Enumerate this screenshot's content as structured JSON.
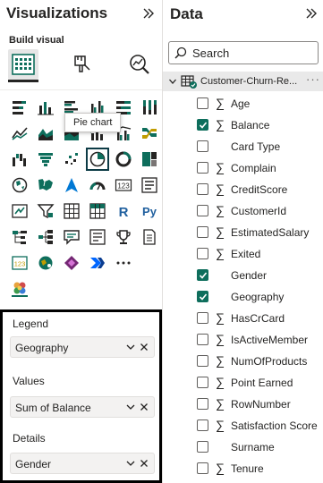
{
  "visualizations": {
    "title": "Visualizations",
    "build_label": "Build visual",
    "tooltip": "Pie chart",
    "wells": [
      {
        "label": "Legend",
        "value": "Geography"
      },
      {
        "label": "Values",
        "value": "Sum of Balance"
      },
      {
        "label": "Details",
        "value": "Gender"
      }
    ]
  },
  "data": {
    "title": "Data",
    "search_placeholder": "Search",
    "table_name": "Customer-Churn-Re...",
    "more": "···",
    "fields": [
      {
        "name": "Age",
        "checked": false,
        "sigma": true
      },
      {
        "name": "Balance",
        "checked": true,
        "sigma": true
      },
      {
        "name": "Card Type",
        "checked": false,
        "sigma": false
      },
      {
        "name": "Complain",
        "checked": false,
        "sigma": true
      },
      {
        "name": "CreditScore",
        "checked": false,
        "sigma": true
      },
      {
        "name": "CustomerId",
        "checked": false,
        "sigma": true
      },
      {
        "name": "EstimatedSalary",
        "checked": false,
        "sigma": true
      },
      {
        "name": "Exited",
        "checked": false,
        "sigma": true
      },
      {
        "name": "Gender",
        "checked": true,
        "sigma": false
      },
      {
        "name": "Geography",
        "checked": true,
        "sigma": false
      },
      {
        "name": "HasCrCard",
        "checked": false,
        "sigma": true
      },
      {
        "name": "IsActiveMember",
        "checked": false,
        "sigma": true
      },
      {
        "name": "NumOfProducts",
        "checked": false,
        "sigma": true
      },
      {
        "name": "Point Earned",
        "checked": false,
        "sigma": true
      },
      {
        "name": "RowNumber",
        "checked": false,
        "sigma": true
      },
      {
        "name": "Satisfaction Score",
        "checked": false,
        "sigma": true
      },
      {
        "name": "Surname",
        "checked": false,
        "sigma": false
      },
      {
        "name": "Tenure",
        "checked": false,
        "sigma": true
      }
    ],
    "sigma_glyph": "∑"
  },
  "colors": {
    "accent": "#0e6e5c",
    "selected_border": "#0d3b45",
    "well_border": "#000000"
  }
}
